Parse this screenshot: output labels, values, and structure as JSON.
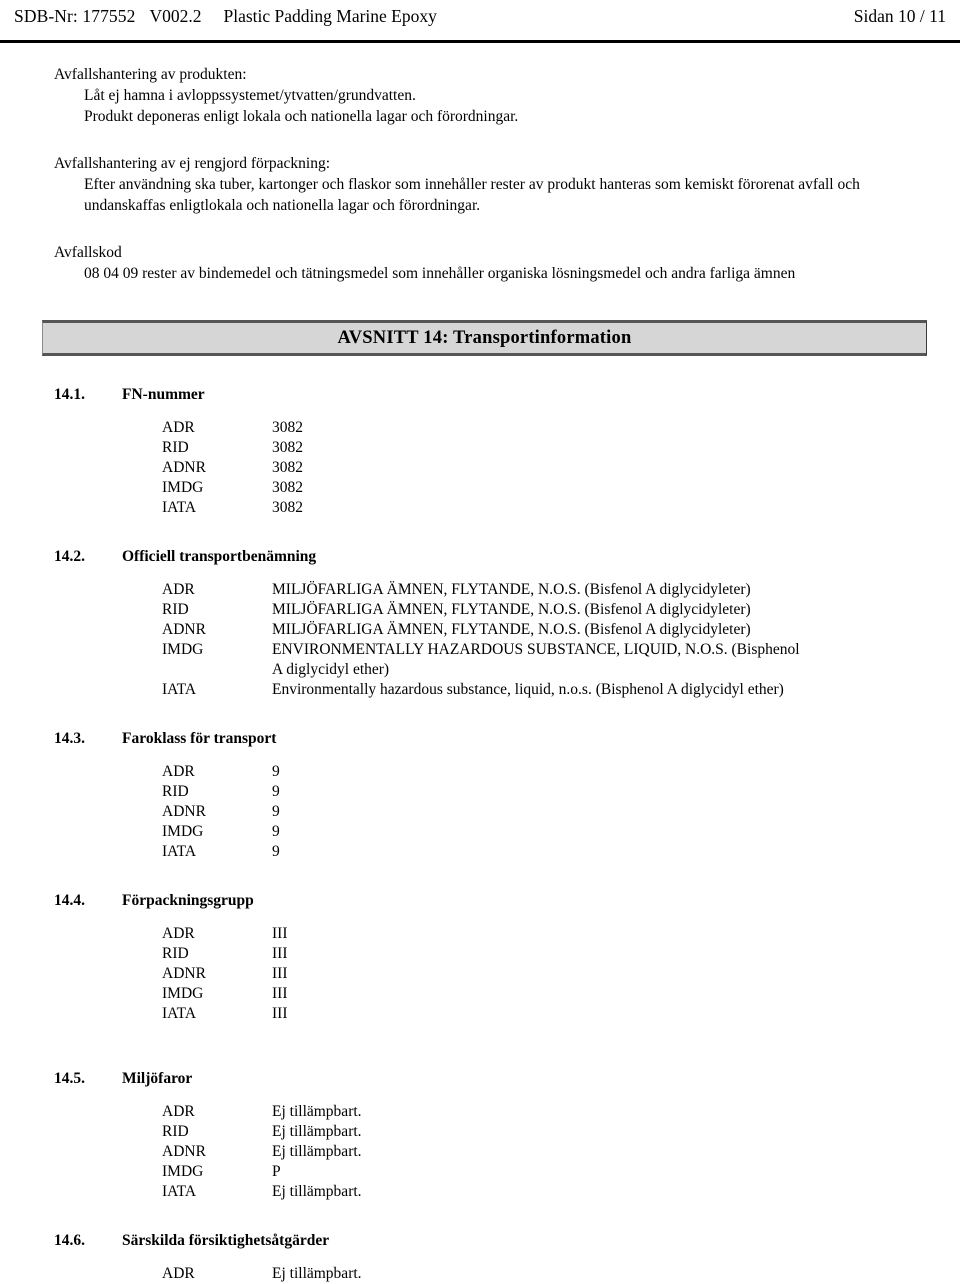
{
  "header": {
    "sdb_nr": "SDB-Nr: 177552",
    "version": "V002.2",
    "product_name": "Plastic Padding Marine Epoxy",
    "page_label": "Sidan 10 / 11"
  },
  "waste": {
    "product_disposal_title": "Avfallshantering av produkten:",
    "product_disposal_line1": "Låt ej hamna i avloppssystemet/ytvatten/grundvatten.",
    "product_disposal_line2": "Produkt deponeras enligt lokala och nationella lagar och förordningar.",
    "packaging_disposal_title": "Avfallshantering av ej rengjord förpackning:",
    "packaging_disposal_line1": "Efter användning ska tuber, kartonger och flaskor som innehåller rester av produkt hanteras som kemiskt förorenat avfall och",
    "packaging_disposal_line2": "undanskaffas enligtlokala och nationella lagar och förordningar.",
    "waste_code_title": "Avfallskod",
    "waste_code_value": "08 04 09 rester av bindemedel och tätningsmedel som innehåller organiska lösningsmedel och andra farliga ämnen"
  },
  "section": {
    "banner": "AVSNITT 14: Transportinformation"
  },
  "sub_14_1": {
    "number": "14.1.",
    "title": "FN-nummer",
    "rows": [
      {
        "key": "ADR",
        "value": "3082"
      },
      {
        "key": "RID",
        "value": "3082"
      },
      {
        "key": "ADNR",
        "value": "3082"
      },
      {
        "key": "IMDG",
        "value": "3082"
      },
      {
        "key": "IATA",
        "value": "3082"
      }
    ]
  },
  "sub_14_2": {
    "number": "14.2.",
    "title": "Officiell transportbenämning",
    "rows": [
      {
        "key": "ADR",
        "value": "MILJÖFARLIGA ÄMNEN, FLYTANDE, N.O.S. (Bisfenol A diglycidyleter)"
      },
      {
        "key": "RID",
        "value": "MILJÖFARLIGA ÄMNEN, FLYTANDE, N.O.S. (Bisfenol A diglycidyleter)"
      },
      {
        "key": "ADNR",
        "value": "MILJÖFARLIGA ÄMNEN, FLYTANDE, N.O.S. (Bisfenol A diglycidyleter)"
      },
      {
        "key": "IMDG",
        "value": "ENVIRONMENTALLY HAZARDOUS SUBSTANCE, LIQUID, N.O.S. (Bisphenol",
        "value_cont": "A diglycidyl ether)"
      },
      {
        "key": "IATA",
        "value": "Environmentally hazardous substance, liquid, n.o.s. (Bisphenol A diglycidyl ether)"
      }
    ]
  },
  "sub_14_3": {
    "number": "14.3.",
    "title": "Faroklass för transport",
    "rows": [
      {
        "key": "ADR",
        "value": "9"
      },
      {
        "key": "RID",
        "value": "9"
      },
      {
        "key": "ADNR",
        "value": "9"
      },
      {
        "key": "IMDG",
        "value": "9"
      },
      {
        "key": "IATA",
        "value": "9"
      }
    ]
  },
  "sub_14_4": {
    "number": "14.4.",
    "title": "Förpackningsgrupp",
    "rows": [
      {
        "key": "ADR",
        "value": "III"
      },
      {
        "key": "RID",
        "value": "III"
      },
      {
        "key": "ADNR",
        "value": "III"
      },
      {
        "key": "IMDG",
        "value": "III"
      },
      {
        "key": "IATA",
        "value": "III"
      }
    ]
  },
  "sub_14_5": {
    "number": "14.5.",
    "title": "Miljöfaror",
    "rows": [
      {
        "key": "ADR",
        "value": "Ej tillämpbart."
      },
      {
        "key": "RID",
        "value": "Ej tillämpbart."
      },
      {
        "key": "ADNR",
        "value": "Ej tillämpbart."
      },
      {
        "key": "IMDG",
        "value": "P"
      },
      {
        "key": "IATA",
        "value": "Ej tillämpbart."
      }
    ]
  },
  "sub_14_6": {
    "number": "14.6.",
    "title": "Särskilda försiktighetsåtgärder",
    "rows": [
      {
        "key": "ADR",
        "value": "Ej tillämpbart."
      }
    ]
  }
}
